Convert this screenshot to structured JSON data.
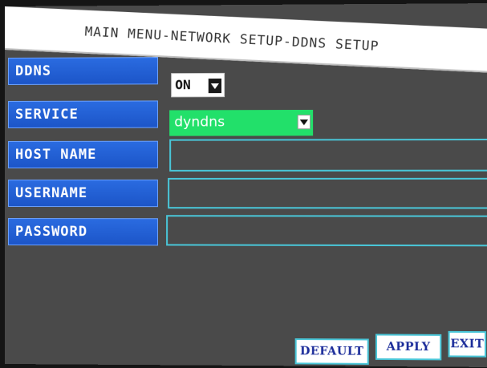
{
  "window": {
    "title": "MAIN MENU-NETWORK SETUP-DDNS SETUP"
  },
  "fields": {
    "ddns": {
      "label": "DDNS",
      "value": "ON"
    },
    "service": {
      "label": "SERVICE",
      "value": "dyndns"
    },
    "host_name": {
      "label": "HOST NAME",
      "value": ""
    },
    "username": {
      "label": "USERNAME",
      "value": ""
    },
    "password": {
      "label": "PASSWORD",
      "value": ""
    }
  },
  "buttons": {
    "default": "DEFAULT",
    "apply": "APPLY",
    "exit": "EXIT"
  },
  "colors": {
    "label_bg": "#2a6be0",
    "field_border": "#49c6d8",
    "service_bg": "#22e06a",
    "panel_bg": "#4a4a4a",
    "button_text": "#1b2c9a"
  }
}
